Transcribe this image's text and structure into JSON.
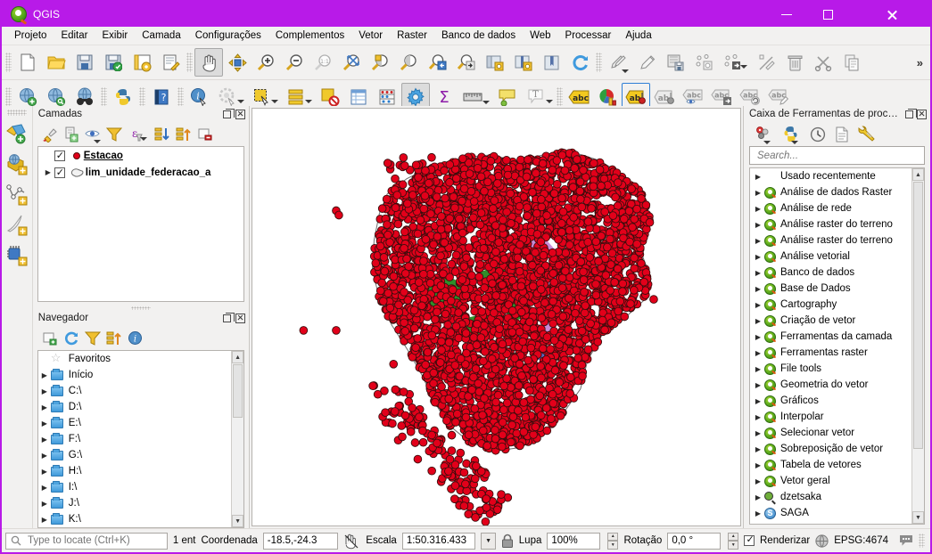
{
  "window": {
    "title": "QGIS",
    "logo_icon": "qgis-logo-icon",
    "minimize_label": "Minimizar",
    "maximize_label": "Maximizar",
    "close_label": "Fechar",
    "titlebar_color": "#b81ae8"
  },
  "menubar": {
    "items": [
      {
        "label": "Projeto"
      },
      {
        "label": "Editar"
      },
      {
        "label": "Exibir"
      },
      {
        "label": "Camada"
      },
      {
        "label": "Configurações"
      },
      {
        "label": "Complementos"
      },
      {
        "label": "Vetor"
      },
      {
        "label": "Raster"
      },
      {
        "label": "Banco de dados"
      },
      {
        "label": "Web"
      },
      {
        "label": "Processar"
      },
      {
        "label": "Ajuda"
      }
    ]
  },
  "toolbar_main": {
    "overflow_label": "»",
    "buttons": [
      {
        "name": "new-project-button",
        "icon": "new-file-icon"
      },
      {
        "name": "open-project-button",
        "icon": "open-folder-icon"
      },
      {
        "name": "save-project-button",
        "icon": "save-icon"
      },
      {
        "name": "save-project-as-button",
        "icon": "save-as-icon"
      },
      {
        "name": "new-print-layout-button",
        "icon": "print-layout-icon"
      },
      {
        "name": "layout-manager-button",
        "icon": "layout-manager-icon"
      },
      {
        "name": "pan-map-button",
        "icon": "pan-hand-icon",
        "pressed": true
      },
      {
        "name": "pan-to-selection-button",
        "icon": "pan-selection-icon"
      },
      {
        "name": "zoom-in-button",
        "icon": "zoom-in-icon"
      },
      {
        "name": "zoom-out-button",
        "icon": "zoom-out-icon"
      },
      {
        "name": "zoom-native-button",
        "icon": "zoom-1to1-icon"
      },
      {
        "name": "zoom-full-button",
        "icon": "zoom-full-icon"
      },
      {
        "name": "zoom-to-selection-button",
        "icon": "zoom-selection-icon"
      },
      {
        "name": "zoom-to-layer-button",
        "icon": "zoom-layer-icon"
      },
      {
        "name": "zoom-last-button",
        "icon": "zoom-last-icon"
      },
      {
        "name": "zoom-next-button",
        "icon": "zoom-next-icon"
      },
      {
        "name": "new-map-view-button",
        "icon": "new-map-view-icon"
      },
      {
        "name": "new-3d-map-view-button",
        "icon": "new-3d-map-view-icon"
      },
      {
        "name": "show-bookmarks-button",
        "icon": "bookmarks-icon"
      },
      {
        "name": "refresh-button",
        "icon": "refresh-icon"
      },
      {
        "name": "current-edits-button",
        "icon": "current-edits-icon"
      },
      {
        "name": "toggle-editing-button",
        "icon": "pencil-icon"
      },
      {
        "name": "save-layer-edits-button",
        "icon": "save-layer-edits-icon"
      },
      {
        "name": "add-feature-button",
        "icon": "add-feature-icon"
      },
      {
        "name": "move-feature-button",
        "icon": "move-feature-icon"
      },
      {
        "name": "vertex-tool-button",
        "icon": "vertex-tool-icon"
      },
      {
        "name": "delete-selected-button",
        "icon": "trash-icon"
      },
      {
        "name": "cut-features-button",
        "icon": "scissors-icon"
      },
      {
        "name": "copy-features-button",
        "icon": "copy-icon"
      }
    ]
  },
  "toolbar_secondary": {
    "buttons": [
      {
        "name": "add-wms-layer-button",
        "icon": "globe-add-icon"
      },
      {
        "name": "data-source-manager-button",
        "icon": "globe-search-icon"
      },
      {
        "name": "metasearch-button",
        "icon": "binoculars-icon"
      },
      {
        "name": "python-console-button",
        "icon": "python-icon"
      },
      {
        "name": "help-button",
        "icon": "help-book-icon"
      },
      {
        "name": "identify-features-button",
        "icon": "identify-info-icon"
      },
      {
        "name": "run-feature-action-button",
        "icon": "feature-action-icon"
      },
      {
        "name": "select-features-button",
        "icon": "select-rectangle-icon"
      },
      {
        "name": "select-by-value-button",
        "icon": "select-by-value-icon"
      },
      {
        "name": "deselect-features-button",
        "icon": "deselect-icon"
      },
      {
        "name": "open-attribute-table-button",
        "icon": "attribute-table-icon"
      },
      {
        "name": "field-calculator-button",
        "icon": "abacus-icon"
      },
      {
        "name": "processing-toolbox-button",
        "icon": "gear-blue-icon",
        "pressed": true
      },
      {
        "name": "statistical-summary-button",
        "icon": "sigma-icon"
      },
      {
        "name": "measure-line-button",
        "icon": "ruler-icon"
      },
      {
        "name": "map-tips-button",
        "icon": "map-tip-icon"
      },
      {
        "name": "new-text-annotation-button",
        "icon": "text-annotation-icon"
      },
      {
        "name": "label-layer-button",
        "icon": "abc-label-icon"
      },
      {
        "name": "style-manager-button",
        "icon": "style-manager-icon"
      },
      {
        "name": "pin-labels-button",
        "icon": "abc-pin-icon",
        "selected": true
      },
      {
        "name": "highlight-pinned-labels-button",
        "icon": "abc-highlight-icon"
      },
      {
        "name": "show-hide-labels-button",
        "icon": "abc-eye-icon"
      },
      {
        "name": "move-label-button",
        "icon": "abc-move-icon"
      },
      {
        "name": "rotate-label-button",
        "icon": "abc-rotate-icon"
      },
      {
        "name": "change-label-button",
        "icon": "abc-edit-icon"
      }
    ]
  },
  "left_toolbar": {
    "buttons": [
      {
        "name": "add-vector-layer-button",
        "icon": "add-vector-layer-icon"
      },
      {
        "name": "add-raster-layer-button",
        "icon": "add-raster-layer-icon"
      },
      {
        "name": "add-mesh-layer-button",
        "icon": "add-mesh-layer-icon"
      },
      {
        "name": "add-delimited-text-layer-button",
        "icon": "add-delimited-text-icon"
      },
      {
        "name": "add-virtual-layer-button",
        "icon": "add-virtual-layer-icon"
      }
    ]
  },
  "layers_panel": {
    "title": "Camadas",
    "float_label": "Desanexar",
    "close_label": "Fechar",
    "toolbar": [
      {
        "name": "open-layer-styling-button",
        "icon": "paintbrush-icon"
      },
      {
        "name": "add-group-button",
        "icon": "add-group-icon"
      },
      {
        "name": "manage-map-themes-button",
        "icon": "eye-themes-icon"
      },
      {
        "name": "filter-legend-button",
        "icon": "filter-icon"
      },
      {
        "name": "filter-legend-expression-button",
        "icon": "epsilon-filter-icon"
      },
      {
        "name": "expand-all-button",
        "icon": "expand-all-icon"
      },
      {
        "name": "collapse-all-button",
        "icon": "collapse-all-icon"
      },
      {
        "name": "remove-layer-button",
        "icon": "remove-layer-icon"
      }
    ],
    "layers": [
      {
        "name": "Estacao",
        "checked": true,
        "expandable": false,
        "symbol": "red-point-symbol",
        "underlined": true
      },
      {
        "name": "lim_unidade_federacao_a",
        "checked": true,
        "expandable": true,
        "symbol": "polygon-symbol",
        "underlined": false
      }
    ]
  },
  "browser_panel": {
    "title": "Navegador",
    "float_label": "Desanexar",
    "close_label": "Fechar",
    "toolbar": [
      {
        "name": "add-selected-layers-button",
        "icon": "add-layer-icon"
      },
      {
        "name": "refresh-button",
        "icon": "refresh-icon"
      },
      {
        "name": "filter-browser-button",
        "icon": "filter-icon"
      },
      {
        "name": "collapse-all-button",
        "icon": "collapse-all-icon"
      },
      {
        "name": "show-properties-button",
        "icon": "info-icon"
      }
    ],
    "items": [
      {
        "label": "Favoritos",
        "icon": "star-icon",
        "expandable": false
      },
      {
        "label": "Início",
        "icon": "folder-icon",
        "expandable": true
      },
      {
        "label": "C:\\",
        "icon": "folder-icon",
        "expandable": true
      },
      {
        "label": "D:\\",
        "icon": "folder-icon",
        "expandable": true
      },
      {
        "label": "E:\\",
        "icon": "folder-icon",
        "expandable": true
      },
      {
        "label": "F:\\",
        "icon": "folder-icon",
        "expandable": true
      },
      {
        "label": "G:\\",
        "icon": "folder-icon",
        "expandable": true
      },
      {
        "label": "H:\\",
        "icon": "folder-icon",
        "expandable": true
      },
      {
        "label": "I:\\",
        "icon": "folder-icon",
        "expandable": true
      },
      {
        "label": "J:\\",
        "icon": "folder-icon",
        "expandable": true
      },
      {
        "label": "K:\\",
        "icon": "folder-icon",
        "expandable": true
      }
    ]
  },
  "processing_panel": {
    "title": "Caixa de Ferramentas de process...",
    "float_label": "Desanexar",
    "close_label": "Fechar",
    "toolbar": [
      {
        "name": "models-button",
        "icon": "models-icon"
      },
      {
        "name": "scripts-button",
        "icon": "python-icon"
      },
      {
        "name": "history-button",
        "icon": "clock-icon"
      },
      {
        "name": "results-viewer-button",
        "icon": "results-document-icon"
      },
      {
        "name": "options-button",
        "icon": "wrench-icon"
      }
    ],
    "search": {
      "placeholder": "Search...",
      "value": ""
    },
    "items": [
      {
        "label": "Usado recentemente",
        "icon": "none"
      },
      {
        "label": "Análise de dados Raster",
        "icon": "qgis-provider-icon"
      },
      {
        "label": "Análise de rede",
        "icon": "qgis-provider-icon"
      },
      {
        "label": "Análise raster do terreno",
        "icon": "qgis-provider-icon"
      },
      {
        "label": "Análise raster do terreno",
        "icon": "qgis-provider-icon"
      },
      {
        "label": "Análise vetorial",
        "icon": "qgis-provider-icon"
      },
      {
        "label": "Banco de dados",
        "icon": "qgis-provider-icon"
      },
      {
        "label": "Base de Dados",
        "icon": "qgis-provider-icon"
      },
      {
        "label": "Cartography",
        "icon": "qgis-provider-icon"
      },
      {
        "label": "Criação de vetor",
        "icon": "qgis-provider-icon"
      },
      {
        "label": "Ferramentas da camada",
        "icon": "qgis-provider-icon"
      },
      {
        "label": "Ferramentas raster",
        "icon": "qgis-provider-icon"
      },
      {
        "label": "File tools",
        "icon": "qgis-provider-icon"
      },
      {
        "label": "Geometria do vetor",
        "icon": "qgis-provider-icon"
      },
      {
        "label": "Gráficos",
        "icon": "qgis-provider-icon"
      },
      {
        "label": "Interpolar",
        "icon": "qgis-provider-icon"
      },
      {
        "label": "Selecionar vetor",
        "icon": "qgis-provider-icon"
      },
      {
        "label": "Sobreposição de vetor",
        "icon": "qgis-provider-icon"
      },
      {
        "label": "Tabela de vetores",
        "icon": "qgis-provider-icon"
      },
      {
        "label": "Vetor geral",
        "icon": "qgis-provider-icon"
      },
      {
        "label": "dzetsaka",
        "icon": "dzetsaka-icon"
      },
      {
        "label": "SAGA",
        "icon": "saga-icon"
      }
    ]
  },
  "map": {
    "name": "map-canvas",
    "background": "#ffffff",
    "point_color": "#e2001a",
    "point_outline": "#3a0d0d",
    "polygon_fill": "#ffffff",
    "polygon_outline": "#6e6e6e",
    "accent_green": "#2f8f2a",
    "accent_purple": "#c98ad6",
    "accent_blue": "#5c6bc8"
  },
  "statusbar": {
    "locator": {
      "placeholder": "Type to locate (Ctrl+K)",
      "value": "",
      "icon": "search-icon"
    },
    "entity_count": "1 ent",
    "coordinate_label": "Coordenada",
    "coordinate_value": "-18.5,-24.3",
    "toggle_extents_icon": "toggle-extents-icon",
    "scale_label": "Escala",
    "scale_value": "1:50.316.433",
    "lock_icon": "lock-icon",
    "magnifier_label": "Lupa",
    "magnifier_value": "100%",
    "rotation_label": "Rotação",
    "rotation_value": "0,0 °",
    "render_label": "Renderizar",
    "render_checked": true,
    "crs_icon": "globe-icon",
    "crs_label": "EPSG:4674",
    "messages_icon": "messages-icon"
  }
}
